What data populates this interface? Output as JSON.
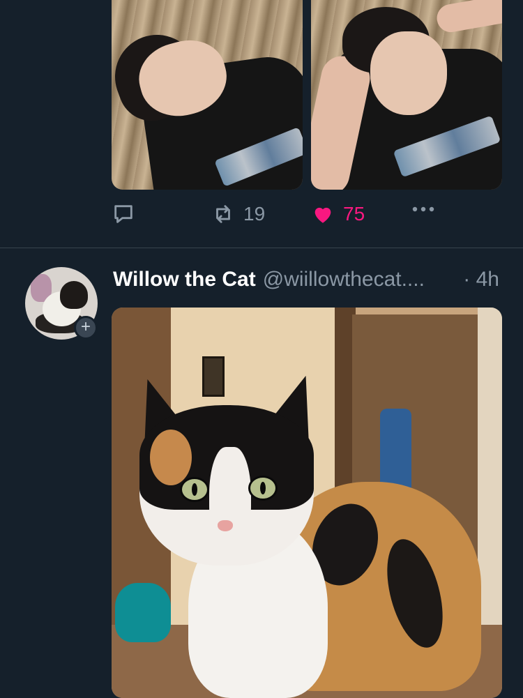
{
  "tweet1": {
    "actions": {
      "reply_count": "",
      "retweet_count": "19",
      "like_count": "75"
    }
  },
  "tweet2": {
    "author_name": "Willow the Cat",
    "author_handle": "@wiillowthecat....",
    "time": "· 4h",
    "follow_symbol": "+"
  },
  "icons": [
    "reply-icon",
    "retweet-icon",
    "heart-icon",
    "more-icon",
    "plus-icon"
  ],
  "colors": {
    "background": "#15202b",
    "secondary_text": "#8b98a5",
    "like_pink": "#f91880",
    "divider": "#38444d"
  }
}
